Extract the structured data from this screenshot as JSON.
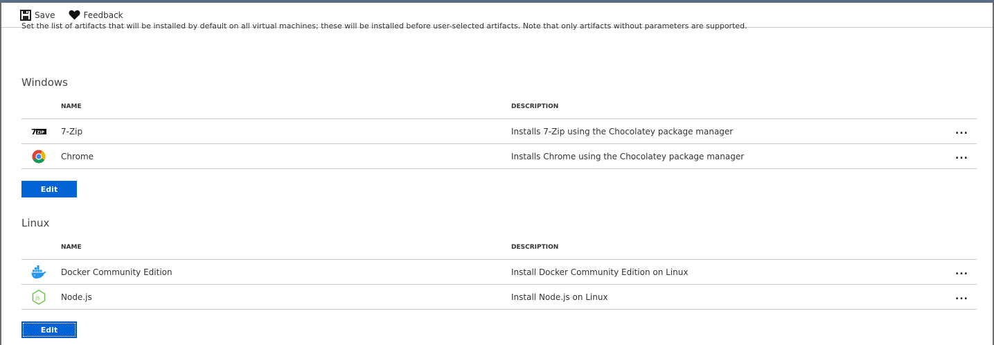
{
  "toolbar": {
    "save_label": "Save",
    "feedback_label": "Feedback"
  },
  "intro_text": "Set the list of artifacts that will be installed by default on all virtual machines; these will be installed before user-selected artifacts. Note that only artifacts without parameters are supported.",
  "columns": {
    "name": "NAME",
    "description": "DESCRIPTION"
  },
  "windows": {
    "title": "Windows",
    "rows": [
      {
        "name": "7-Zip",
        "description": "Installs 7-Zip using the Chocolatey package manager",
        "icon": "7zip-icon",
        "more": "..."
      },
      {
        "name": "Chrome",
        "description": "Installs Chrome using the Chocolatey package manager",
        "icon": "chrome-icon",
        "more": "..."
      }
    ],
    "edit_label": "Edit"
  },
  "linux": {
    "title": "Linux",
    "rows": [
      {
        "name": "Docker Community Edition",
        "description": "Install Docker Community Edition on Linux",
        "icon": "docker-icon",
        "more": "..."
      },
      {
        "name": "Node.js",
        "description": "Install Node.js on Linux",
        "icon": "nodejs-icon",
        "more": "..."
      }
    ],
    "edit_label": "Edit"
  },
  "colors": {
    "accent": "#0063d6",
    "border_top": "#5a6f86"
  }
}
